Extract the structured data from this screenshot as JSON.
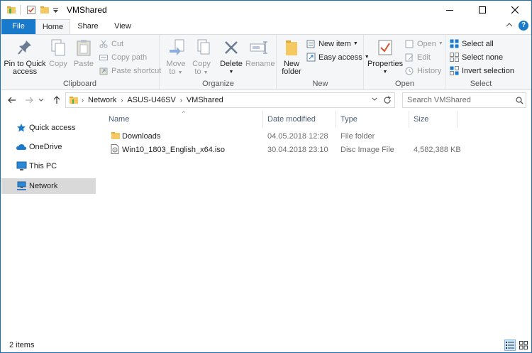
{
  "window": {
    "title": "VMShared"
  },
  "tabs": {
    "file": "File",
    "home": "Home",
    "share": "Share",
    "view": "View"
  },
  "ribbon": {
    "clipboard": {
      "label": "Clipboard",
      "pin_line1": "Pin to Quick",
      "pin_line2": "access",
      "copy": "Copy",
      "paste": "Paste",
      "cut": "Cut",
      "copy_path": "Copy path",
      "paste_shortcut": "Paste shortcut"
    },
    "organize": {
      "label": "Organize",
      "move_line1": "Move",
      "move_line2": "to",
      "copy_line1": "Copy",
      "copy_line2": "to",
      "delete": "Delete",
      "rename": "Rename"
    },
    "new": {
      "label": "New",
      "new_folder_line1": "New",
      "new_folder_line2": "folder",
      "new_item": "New item",
      "easy_access": "Easy access"
    },
    "open": {
      "label": "Open",
      "properties": "Properties",
      "open": "Open",
      "edit": "Edit",
      "history": "History"
    },
    "select": {
      "label": "Select",
      "select_all": "Select all",
      "select_none": "Select none",
      "invert_selection": "Invert selection"
    }
  },
  "address": {
    "crumbs": [
      "Network",
      "ASUS-U46SV",
      "VMShared"
    ],
    "search_placeholder": "Search VMShared"
  },
  "navpane": {
    "items": [
      {
        "label": "Quick access",
        "icon": "star-icon"
      },
      {
        "label": "OneDrive",
        "icon": "cloud-icon"
      },
      {
        "label": "This PC",
        "icon": "monitor-icon"
      },
      {
        "label": "Network",
        "icon": "network-icon"
      }
    ]
  },
  "columns": {
    "name": "Name",
    "date": "Date modified",
    "type": "Type",
    "size": "Size"
  },
  "files": [
    {
      "name": "Downloads",
      "date": "04.05.2018 12:28",
      "type": "File folder",
      "size": ""
    },
    {
      "name": "Win10_1803_English_x64.iso",
      "date": "30.04.2018 23:10",
      "type": "Disc Image File",
      "size": "4,582,388 KB"
    }
  ],
  "status": {
    "item_count": "2 items"
  },
  "colors": {
    "accent": "#1979ca",
    "folder": "#f5c862",
    "selected_nav": "#d9d9d9"
  }
}
